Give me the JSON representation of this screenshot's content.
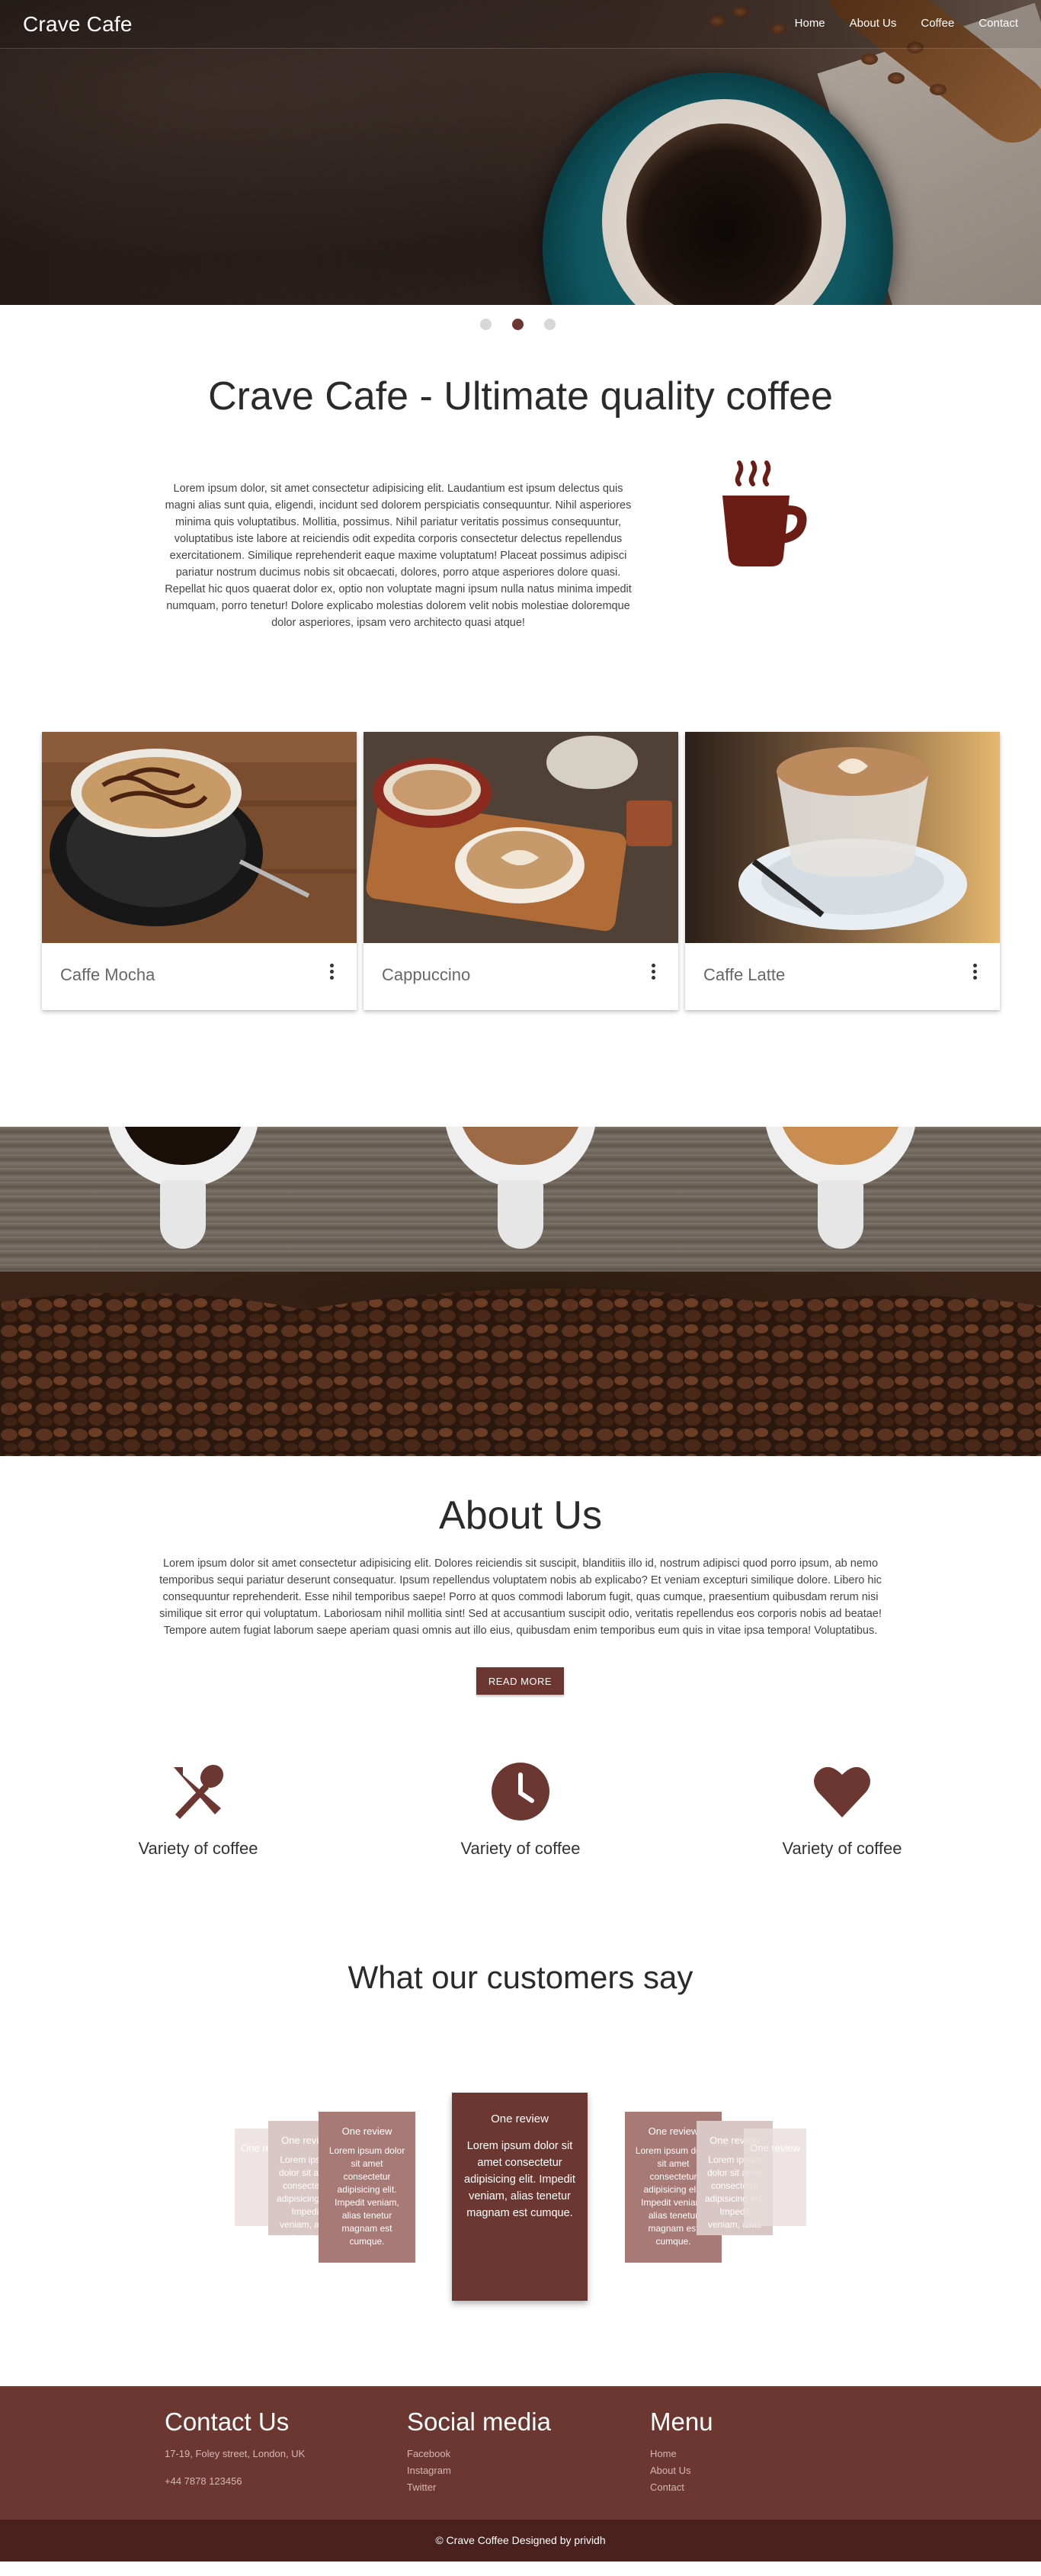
{
  "header": {
    "brand": "Crave Cafe",
    "nav": [
      "Home",
      "About Us",
      "Coffee",
      "Contact"
    ]
  },
  "carousel": {
    "slide_count": 3,
    "active_index": 1
  },
  "hero_section": {
    "heading": "Crave Cafe - Ultimate quality coffee",
    "body": "Lorem ipsum dolor, sit amet consectetur adipisicing elit. Laudantium est ipsum delectus quis magni alias sunt quia, eligendi, incidunt sed dolorem perspiciatis consequuntur. Nihil asperiores minima quis voluptatibus. Mollitia, possimus. Nihil pariatur veritatis possimus consequuntur, voluptatibus iste labore at reiciendis odit expedita corporis consectetur delectus repellendus exercitationem. Similique reprehenderit eaque maxime voluptatum! Placeat possimus adipisci pariatur nostrum ducimus nobis sit obcaecati, dolores, porro atque asperiores dolore quasi. Repellat hic quos quaerat dolor ex, optio non voluptate magni ipsum nulla natus minima impedit numquam, porro tenetur! Dolore explicabo molestias dolorem velit nobis molestiae doloremque dolor asperiores, ipsam vero architecto quasi atque!",
    "icon": "coffee-cup-icon",
    "accent_color": "#6b1c15"
  },
  "products": [
    {
      "name": "Caffe Mocha",
      "menu_icon": "more-vertical-icon"
    },
    {
      "name": "Cappuccino",
      "menu_icon": "more-vertical-icon"
    },
    {
      "name": "Caffe Latte",
      "menu_icon": "more-vertical-icon"
    }
  ],
  "about": {
    "title": "About Us",
    "body": "Lorem ipsum dolor sit amet consectetur adipisicing elit. Dolores reiciendis sit suscipit, blanditiis illo id, nostrum adipisci quod porro ipsum, ab nemo temporibus sequi pariatur deserunt consequatur. Ipsum repellendus voluptatem nobis ab explicabo? Et veniam excepturi similique dolore. Libero hic consequuntur reprehenderit. Esse nihil temporibus saepe! Porro at quos commodi laborum fugit, quas cumque, praesentium quibusdam rerum nisi similique sit error qui voluptatum. Laboriosam nihil mollitia sint! Sed at accusantium suscipit odio, veritatis repellendus eos corporis nobis ad beatae! Tempore autem fugiat laborum saepe aperiam quasi omnis aut illo eius, quibusdam enim temporibus eum quis in vitae ipsa tempora! Voluptatibus.",
    "button": "READ MORE"
  },
  "features": [
    {
      "icon": "spoon-fork-icon",
      "label": "Variety of coffee"
    },
    {
      "icon": "clock-icon",
      "label": "Variety of coffee"
    },
    {
      "icon": "heart-icon",
      "label": "Variety of coffee"
    }
  ],
  "testimonials": {
    "title": "What our customers say",
    "review_title": "One review",
    "review_body": "Lorem ipsum dolor sit amet consectetur adipisicing elit. Impedit veniam, alias tenetur magnam est cumque."
  },
  "footer": {
    "contact": {
      "title": "Contact Us",
      "address": "17-19, Foley street, London, UK",
      "phone": "+44 7878 123456"
    },
    "social": {
      "title": "Social media",
      "links": [
        "Facebook",
        "Instagram",
        "Twitter"
      ]
    },
    "menu": {
      "title": "Menu",
      "links": [
        "Home",
        "About Us",
        "Contact"
      ]
    },
    "copyright": "© Crave Coffee Designed by prividh"
  },
  "colors": {
    "primary": "#6b3730",
    "footer_bottom": "#4a211d",
    "link": "#d5b7b3"
  }
}
